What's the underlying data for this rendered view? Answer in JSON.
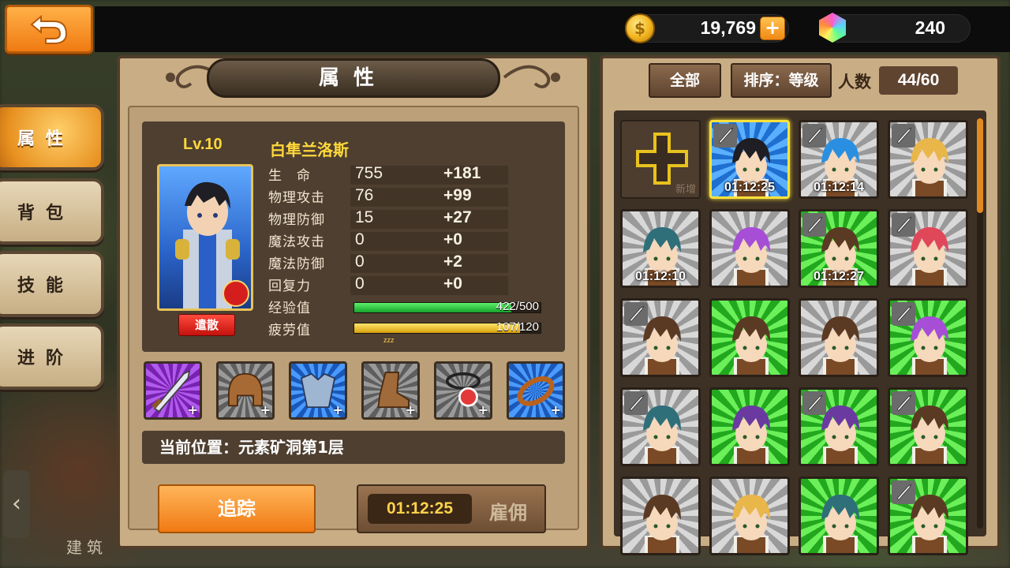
{
  "header": {
    "coins": "19,769",
    "coin_plus": "+",
    "gems": "240"
  },
  "sidebar": {
    "items": [
      {
        "label": "属性",
        "active": true
      },
      {
        "label": "背包",
        "active": false
      },
      {
        "label": "技能",
        "active": false
      },
      {
        "label": "进阶",
        "active": false
      }
    ],
    "build_label": "建筑"
  },
  "attributes_panel": {
    "title": "属性",
    "level": "Lv.10",
    "hero_name": "白隼󠄀兰洛斯",
    "dismiss_label": "遣散",
    "stats": [
      {
        "label": "生　命",
        "base": "755",
        "bonus": "+181"
      },
      {
        "label": "物理攻击",
        "base": "76",
        "bonus": "+99"
      },
      {
        "label": "物理防御",
        "base": "15",
        "bonus": "+27"
      },
      {
        "label": "魔法攻击",
        "base": "0",
        "bonus": "+0"
      },
      {
        "label": "魔法防御",
        "base": "0",
        "bonus": "+2"
      },
      {
        "label": "回复力",
        "base": "0",
        "bonus": "+0"
      }
    ],
    "exp": {
      "label": "经验值",
      "text": "422/500",
      "value": 422,
      "max": 500
    },
    "fatigue": {
      "label": "疲劳值",
      "text": "107/120",
      "value": 107,
      "max": 120,
      "marker": "zzz"
    },
    "equipment": [
      {
        "name": "sword-icon",
        "bg": "#9a3bd6"
      },
      {
        "name": "helmet-icon",
        "bg": "#7a7a7a"
      },
      {
        "name": "armor-icon",
        "bg": "#2a78d6"
      },
      {
        "name": "boots-icon",
        "bg": "#7a7a7a"
      },
      {
        "name": "amulet-icon",
        "bg": "#7a7a7a"
      },
      {
        "name": "ring-icon",
        "bg": "#2a78d6"
      }
    ],
    "equip_plus": "+",
    "location": "当前位置：元素矿洞第1层",
    "track_label": "追踪",
    "hire_time": "01:12:25",
    "hire_label": "雇佣"
  },
  "roster_panel": {
    "filter_all": "全部",
    "sort_label": "排序：等级",
    "count_label": "人数",
    "count_value": "44/60",
    "add_label": "新增",
    "cards": [
      {
        "bg": "blue",
        "timer": "01:12:25",
        "sword": true,
        "hair": "#1e1e24",
        "selected": true
      },
      {
        "bg": "gray",
        "timer": "01:12:14",
        "sword": true,
        "hair": "#2a8fe0",
        "selected": false
      },
      {
        "bg": "gray",
        "timer": "",
        "sword": true,
        "hair": "#e9b64a",
        "selected": false
      },
      {
        "bg": "gray",
        "timer": "01:12:10",
        "sword": false,
        "hair": "#2f6f7a",
        "selected": false
      },
      {
        "bg": "gray",
        "timer": "",
        "sword": false,
        "hair": "#a64ed6",
        "selected": false
      },
      {
        "bg": "green",
        "timer": "01:12:27",
        "sword": true,
        "hair": "#5b3a24",
        "selected": false
      },
      {
        "bg": "gray",
        "timer": "",
        "sword": true,
        "hair": "#e0485a",
        "selected": false
      },
      {
        "bg": "gray",
        "timer": "",
        "sword": true,
        "hair": "#5b3a24",
        "selected": false
      },
      {
        "bg": "green",
        "timer": "",
        "sword": false,
        "hair": "#5b3a24",
        "selected": false
      },
      {
        "bg": "gray",
        "timer": "",
        "sword": false,
        "hair": "#5b3a24",
        "selected": false
      },
      {
        "bg": "green",
        "timer": "",
        "sword": true,
        "hair": "#a64ed6",
        "selected": false
      },
      {
        "bg": "gray",
        "timer": "",
        "sword": true,
        "hair": "#2f6f7a",
        "selected": false
      },
      {
        "bg": "green",
        "timer": "",
        "sword": false,
        "hair": "#6a3aa0",
        "selected": false
      },
      {
        "bg": "green",
        "timer": "",
        "sword": true,
        "hair": "#6a3aa0",
        "selected": false
      },
      {
        "bg": "green",
        "timer": "",
        "sword": true,
        "hair": "#5b3a24",
        "selected": false
      },
      {
        "bg": "gray",
        "timer": "",
        "sword": false,
        "hair": "#5b3a24",
        "selected": false
      },
      {
        "bg": "gray",
        "timer": "",
        "sword": false,
        "hair": "#e9b64a",
        "selected": false
      },
      {
        "bg": "green",
        "timer": "",
        "sword": false,
        "hair": "#2f6f7a",
        "selected": false
      },
      {
        "bg": "green",
        "timer": "",
        "sword": true,
        "hair": "#5b3a24",
        "selected": false
      }
    ]
  },
  "colors": {
    "accent_orange": "#f07a12",
    "gold_text": "#ffd83a",
    "exp_bar": "#22c43a",
    "fatigue_bar": "#f2c81a",
    "panel_bg": "#c9ad85"
  }
}
